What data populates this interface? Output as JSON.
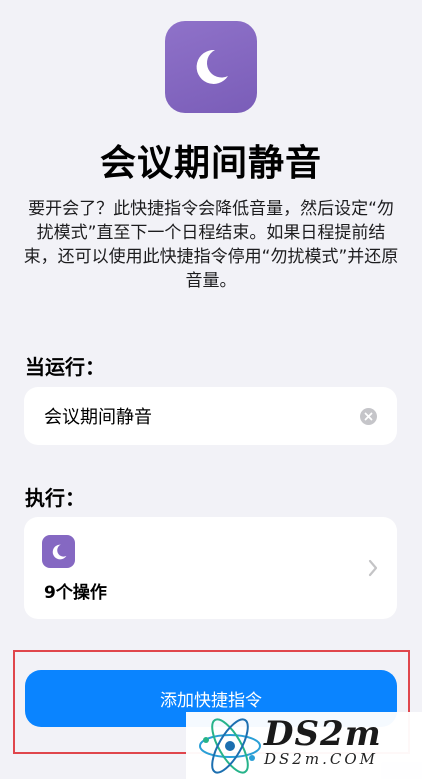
{
  "shortcut": {
    "title": "会议期间静音",
    "description": "要开会了？此快捷指令会降低音量，然后设定“勿扰模式”直至下一个日程结束。如果日程提前结束，还可以使用此快捷指令停用“勿扰模式”并还原音量。",
    "icon": "moon-icon",
    "accent_color": "#7e62bf"
  },
  "when_run": {
    "label": "当运行：",
    "value": "会议期间静音",
    "clear_icon": "clear-icon"
  },
  "do": {
    "label": "执行：",
    "action_count": "9个操作",
    "icon": "moon-icon",
    "chevron": "chevron-right-icon"
  },
  "primary_button": {
    "label": "添加快捷指令",
    "color": "#0a84ff"
  },
  "highlight_color": "#e0464c",
  "watermark": {
    "main": "DS2m",
    "sub": "DS2m.COM"
  }
}
